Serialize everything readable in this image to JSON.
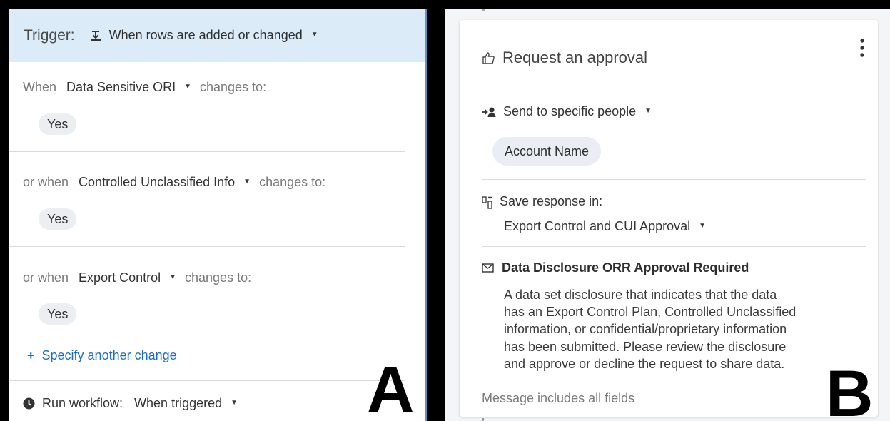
{
  "panel_a": {
    "letter": "A",
    "trigger": {
      "label": "Trigger:",
      "value": "When rows are added or changed",
      "icon": "trigger-icon"
    },
    "conditions": [
      {
        "prefix": "When",
        "field": "Data Sensitive ORI",
        "suffix": "changes to:",
        "value": "Yes"
      },
      {
        "prefix": "or when",
        "field": "Controlled Unclassified Info",
        "suffix": "changes to:",
        "value": "Yes"
      },
      {
        "prefix": "or when",
        "field": "Export Control",
        "suffix": "changes to:",
        "value": "Yes"
      }
    ],
    "specify_link": {
      "plus": "+",
      "label": "Specify another change"
    },
    "run": {
      "label": "Run workflow:",
      "value": "When triggered",
      "icon": "clock-icon"
    }
  },
  "panel_b": {
    "letter": "B",
    "title": "Request an approval",
    "title_icon": "thumbs-up-icon",
    "send": {
      "label": "Send to specific people",
      "icon": "add-person-icon",
      "recipient": "Account Name"
    },
    "save": {
      "label": "Save response in:",
      "value": "Export Control and CUI Approval",
      "icon": "save-column-icon"
    },
    "message": {
      "icon": "mail-icon",
      "subject": "Data Disclosure ORR Approval Required",
      "body_lines": [
        "A data set disclosure that indicates that the data",
        "has an Export Control Plan, Controlled Unclassified",
        "information, or confidential/proprietary information",
        "has been submitted. Please review the disclosure",
        "and approve or decline the request to share data."
      ],
      "footer": "Message includes all fields"
    }
  },
  "colors": {
    "trigger_bar": "#dcebf8",
    "link": "#1f6fb8",
    "chip": "#eceff2",
    "panel_b_bg": "#f4f5f7"
  }
}
